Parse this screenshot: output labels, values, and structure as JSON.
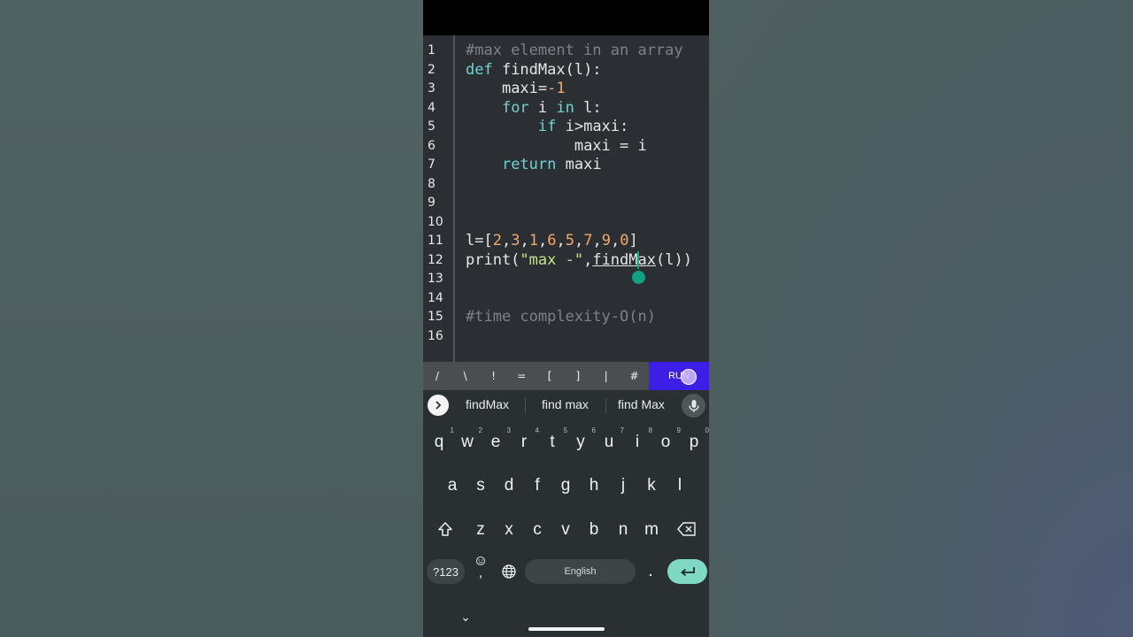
{
  "editor": {
    "line_numbers": [
      "1",
      "2",
      "3",
      "4",
      "5",
      "6",
      "7",
      "8",
      "9",
      "10",
      "11",
      "12",
      "13",
      "14",
      "15",
      "16"
    ],
    "lines": {
      "l1": {
        "comment": "#max element in an array"
      },
      "l2": {
        "kw": "def",
        "rest": " findMax(l):"
      },
      "l3": {
        "indent": "    ",
        "text": "maxi=",
        "num": "-1"
      },
      "l4": {
        "indent": "    ",
        "kw1": "for",
        "mid": " i ",
        "kw2": "in",
        "rest": " l:"
      },
      "l5": {
        "indent": "        ",
        "kw": "if",
        "rest": " i>maxi:"
      },
      "l6": {
        "indent": "            ",
        "text": "maxi = i"
      },
      "l7": {
        "indent": "    ",
        "kw": "return",
        "rest": " maxi"
      },
      "l11": {
        "a": "l=[",
        "n1": "2",
        "c1": ",",
        "n2": "3",
        "c2": ",",
        "n3": "1",
        "c3": ",",
        "n4": "6",
        "c4": ",",
        "n5": "5",
        "c5": ",",
        "n6": "7",
        "c6": ",",
        "n7": "9",
        "c7": ",",
        "n8": "0",
        "b": "]"
      },
      "l12": {
        "a": "print(",
        "str": "\"max -\"",
        "comma": ",",
        "fn": "findMax",
        "rest": "(l))"
      },
      "l15": {
        "comment": "#time complexity-O(n)"
      }
    }
  },
  "symbol_bar": {
    "symbols": [
      "/",
      "\\",
      "!",
      "=",
      "[",
      "]",
      "|",
      "#"
    ],
    "run_label": "RUN"
  },
  "keyboard": {
    "suggestions": [
      "findMax",
      "find max",
      "find Max"
    ],
    "row1": [
      "q",
      "w",
      "e",
      "r",
      "t",
      "y",
      "u",
      "i",
      "o",
      "p"
    ],
    "row1_hints": [
      "1",
      "2",
      "3",
      "4",
      "5",
      "6",
      "7",
      "8",
      "9",
      "0"
    ],
    "row2": [
      "a",
      "s",
      "d",
      "f",
      "g",
      "h",
      "j",
      "k",
      "l"
    ],
    "row3": [
      "z",
      "x",
      "c",
      "v",
      "b",
      "n",
      "m"
    ],
    "symbols_key": "?123",
    "comma_key": ",",
    "space_label": "English",
    "period_key": ".",
    "hide_key": "⌄"
  },
  "colors": {
    "run_button": "#3d1ee6",
    "enter_key": "#7fd8c4",
    "cursor": "#13a080"
  }
}
